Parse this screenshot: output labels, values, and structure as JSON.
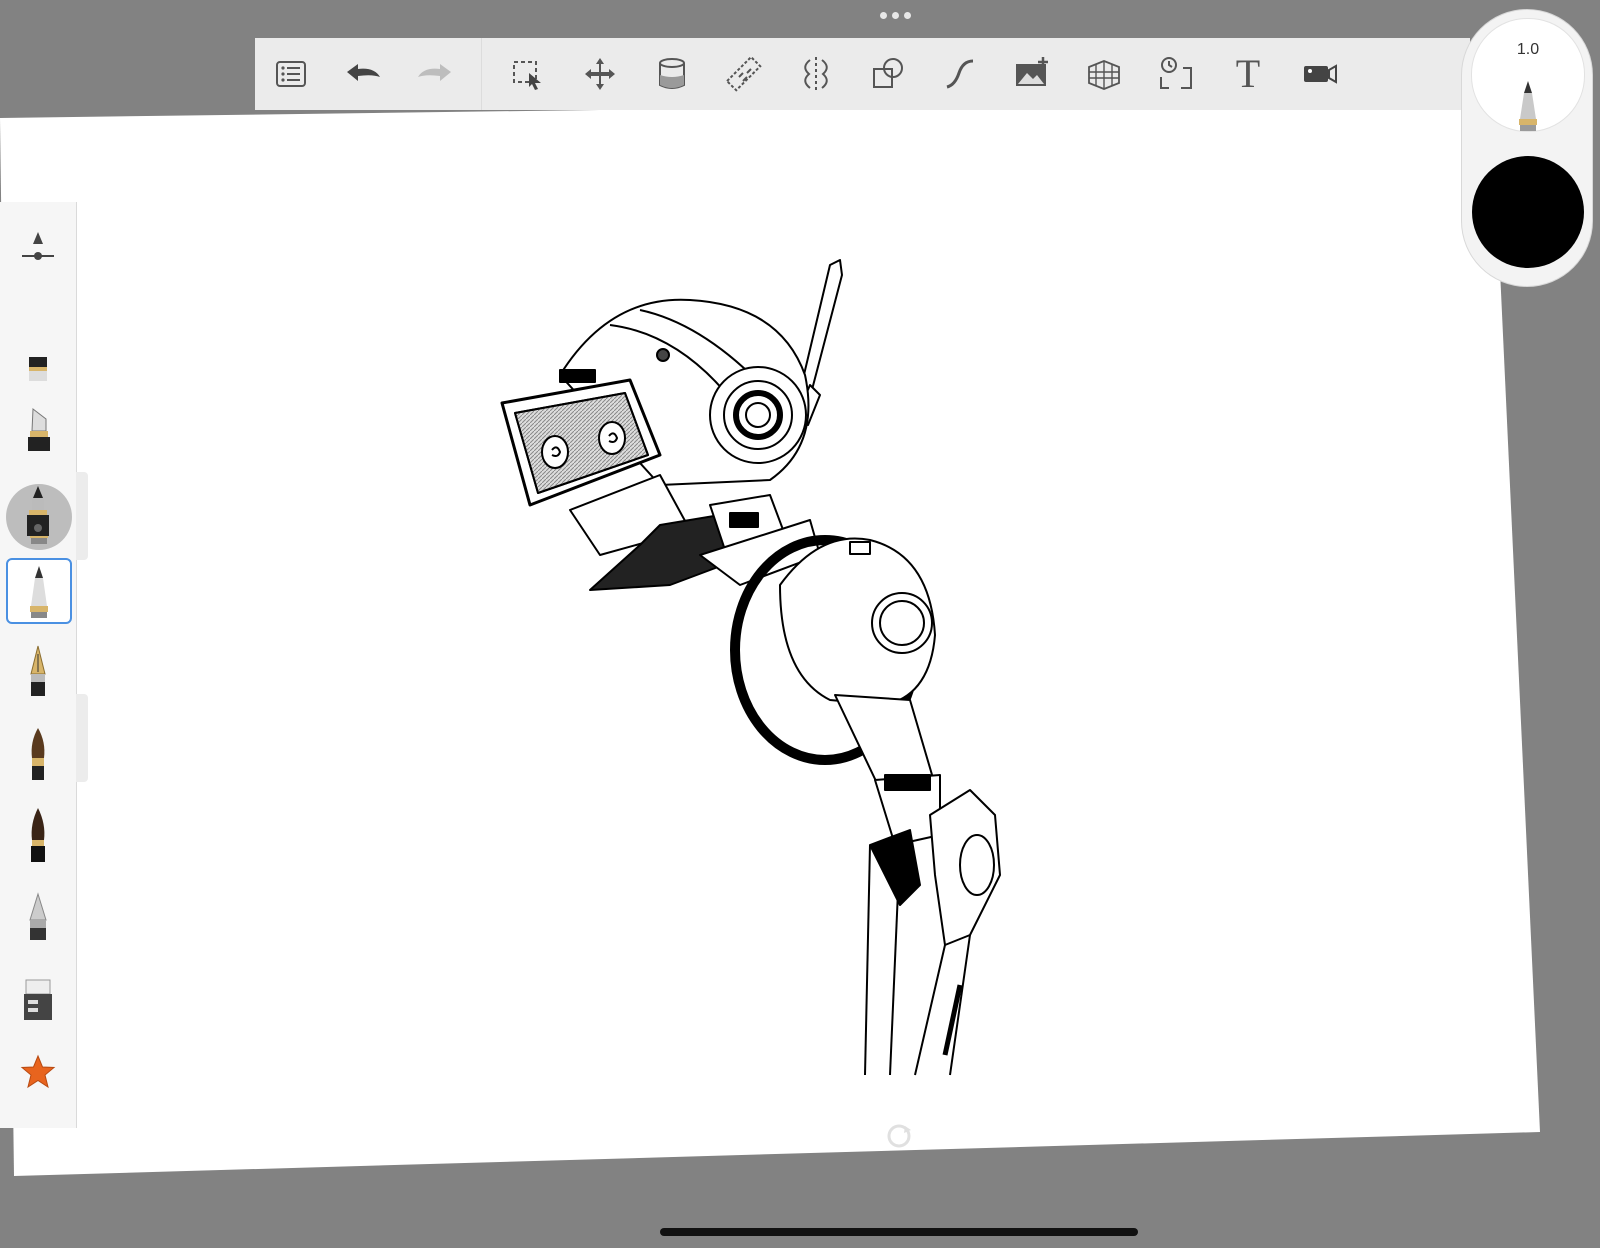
{
  "toolbar": {
    "items": [
      {
        "name": "menu-list-icon"
      },
      {
        "name": "undo-icon"
      },
      {
        "name": "redo-icon"
      },
      {
        "name": "selection-icon"
      },
      {
        "name": "transform-icon"
      },
      {
        "name": "fill-icon"
      },
      {
        "name": "ruler-icon"
      },
      {
        "name": "symmetry-icon"
      },
      {
        "name": "shapes-icon"
      },
      {
        "name": "curve-icon"
      },
      {
        "name": "import-image-icon"
      },
      {
        "name": "perspective-icon"
      },
      {
        "name": "time-lapse-icon"
      },
      {
        "name": "text-icon"
      },
      {
        "name": "video-icon"
      }
    ],
    "text_tool_glyph": "T"
  },
  "brush": {
    "size": "1.0",
    "color": "#000000"
  },
  "sidebar": {
    "brushes": [
      {
        "name": "brush-marker-icon"
      },
      {
        "name": "brush-chisel-icon"
      },
      {
        "name": "brush-ink-icon"
      },
      {
        "name": "brush-pencil-icon",
        "selected": true
      },
      {
        "name": "brush-fountain-pen-icon"
      },
      {
        "name": "brush-paint-icon"
      },
      {
        "name": "brush-dark-paint-icon"
      },
      {
        "name": "brush-airbrush-icon"
      },
      {
        "name": "brush-eraser-icon"
      },
      {
        "name": "favorites-star-icon"
      }
    ],
    "accent": "#4a90e2",
    "star_color": "#e8641e"
  }
}
